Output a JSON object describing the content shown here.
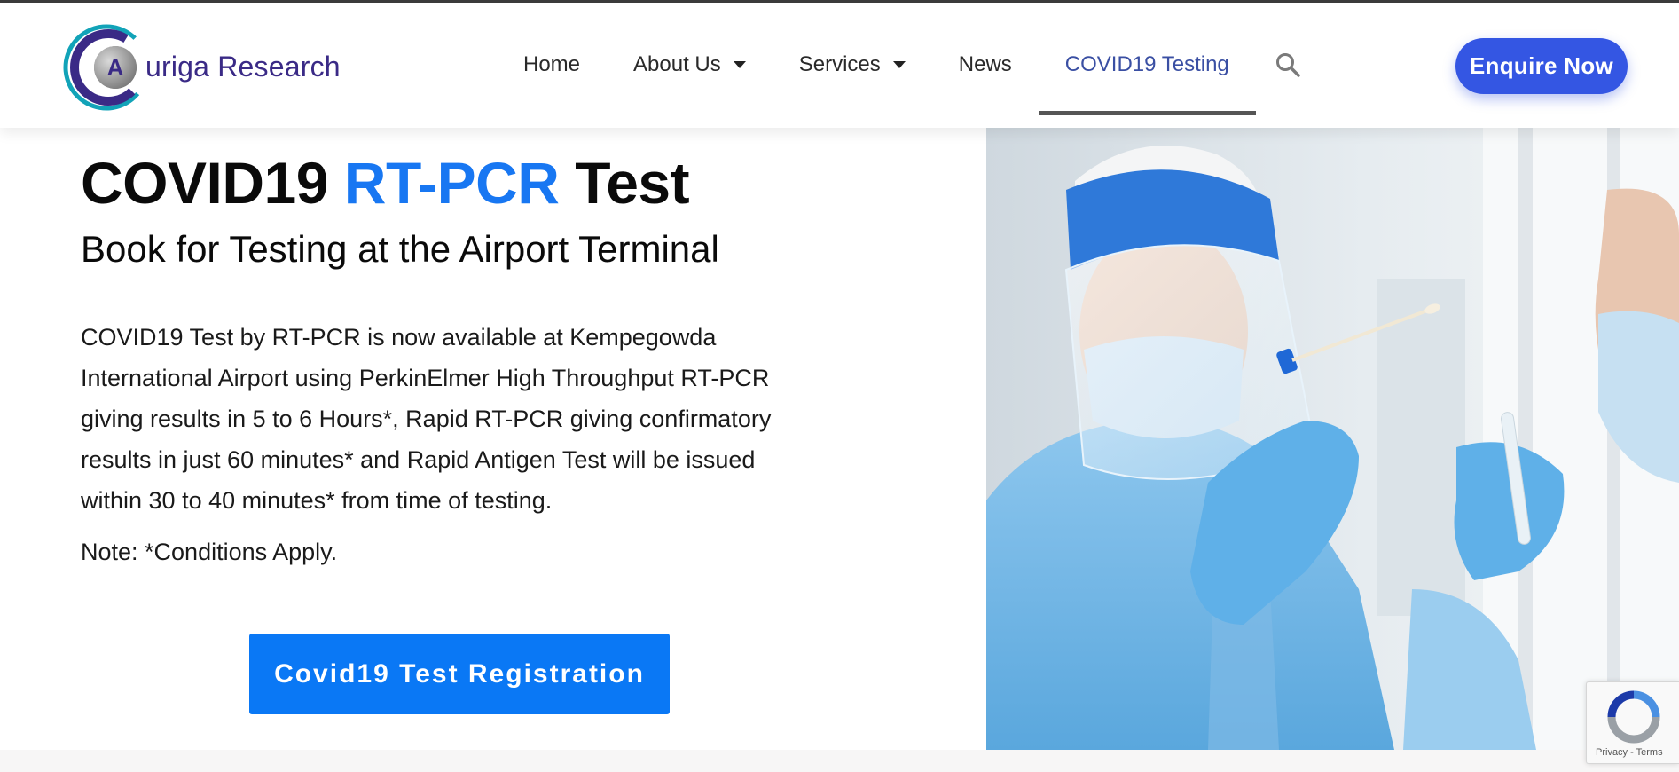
{
  "brand": {
    "logo_letter": "A",
    "name": "uriga Research",
    "colors": {
      "navy": "#3a2a86",
      "teal": "#12a3b8",
      "gray": "#7a7a7a"
    }
  },
  "nav": {
    "items": [
      {
        "label": "Home",
        "dropdown": false,
        "active": false
      },
      {
        "label": "About Us",
        "dropdown": true,
        "active": false
      },
      {
        "label": "Services",
        "dropdown": true,
        "active": false
      },
      {
        "label": "News",
        "dropdown": false,
        "active": false
      },
      {
        "label": "COVID19 Testing",
        "dropdown": false,
        "active": true
      }
    ],
    "search_icon": "search-icon",
    "enquire_label": "Enquire Now"
  },
  "hero": {
    "title_part1": "COVID19 ",
    "title_part2": "RT-PCR",
    "title_part3": " Test",
    "subtitle": "Book for Testing at the Airport Terminal",
    "body": "COVID19 Test by RT-PCR is now available at Kempegowda International Airport using PerkinElmer High Throughput RT-PCR giving results in 5 to 6 Hours*, Rapid RT-PCR  giving confirmatory results in just 60 minutes* and Rapid Antigen Test will be issued within 30 to 40 minutes* from time of testing.",
    "note": "Note:  *Conditions Apply.",
    "cta_label": "Covid19 Test Registration"
  },
  "recaptcha": {
    "terms": "Privacy - Terms"
  },
  "colors": {
    "accent": "#1877f2",
    "enquire": "#3456e3",
    "cta": "#0a78f5",
    "active_nav": "#3a4fa3"
  }
}
